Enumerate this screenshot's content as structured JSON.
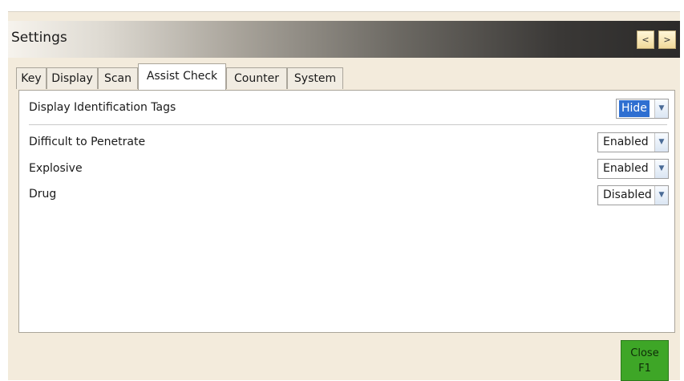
{
  "window": {
    "title": "Settings"
  },
  "nav": {
    "prev_label": "<",
    "next_label": ">"
  },
  "tabs": [
    "Key",
    "Display",
    "Scan",
    "Assist Check",
    "Counter",
    "System"
  ],
  "active_tab": "Assist Check",
  "settings": {
    "identification": {
      "label": "Display Identification Tags",
      "value": "Hide"
    },
    "rows": [
      {
        "label": "Difficult to Penetrate",
        "value": "Enabled"
      },
      {
        "label": "Explosive",
        "value": "Enabled"
      },
      {
        "label": "Drug",
        "value": "Disabled"
      }
    ]
  },
  "close": {
    "label": "Close",
    "shortcut": "F1"
  },
  "colors": {
    "accent_select": "#2f6fd1",
    "close_button": "#3ea627"
  },
  "icons": {
    "dropdown": "chevron-down-icon"
  }
}
